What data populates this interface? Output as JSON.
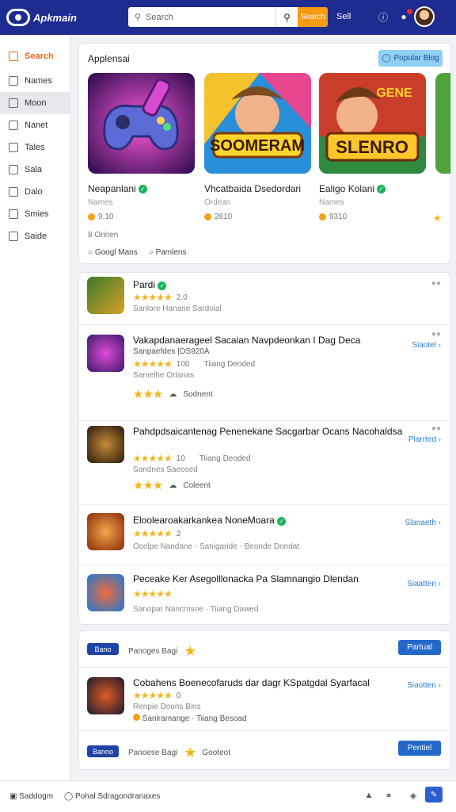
{
  "header": {
    "logo_text": "Apkmain",
    "search_placeholder": "Search",
    "search_go": "Search",
    "link": "Sell"
  },
  "sidebar": {
    "items": [
      {
        "label": "Search"
      },
      {
        "label": "Names"
      },
      {
        "label": "Moon"
      },
      {
        "label": "Nanet"
      },
      {
        "label": "Tales"
      },
      {
        "label": "Sala"
      },
      {
        "label": "Dalo"
      },
      {
        "label": "Smies"
      },
      {
        "label": "Saide"
      }
    ]
  },
  "featured": {
    "title": "Applensai",
    "button": "Popular Blog",
    "tiles": [
      {
        "name": "Neapanlani",
        "sub": "Names",
        "rating": "9.10"
      },
      {
        "name": "Vhcatbaida Dsedordari",
        "sub": "Ordean",
        "rating": "2810"
      },
      {
        "name": "Ealigo Kolani",
        "sub": "Names",
        "rating": "9310"
      }
    ],
    "foot1": "8 Orinen",
    "foot2a": "Googl Mans",
    "foot2b": "Pamlens"
  },
  "list": [
    {
      "title": "Pardi",
      "rating": "2.0",
      "meta": "Sanlore Hanane Sardolal"
    },
    {
      "title": "Vakapdanaerageel Sacaian Navpdeonkan I Dag Deca",
      "sub": "Sanpaefdes |OS920A",
      "rating": "100",
      "meta": "Samelhe Orlanas",
      "extra": "Tiiang Deoded",
      "mini": "Sodnent",
      "link": "Siaotel"
    },
    {
      "title": "Pahdpdsaicantenag Penenekane Sacgarbar Ocans Nacohaldsa",
      "rating": "10",
      "meta": "Sandnes Saeosed",
      "extra": "Tiiang Deoded",
      "mini": "Coleent",
      "link": "Plarrted"
    },
    {
      "title": "Eloolearoakarkankea NoneMoara",
      "rating": "2",
      "meta": "Ocelpe Nandane · Sanigaride · Beonde Dondat",
      "link": "Slanaeth"
    },
    {
      "title": "Peceake Ker Asegolllonacka Pa Slamnangio Dlendan",
      "meta": "Sanopar Nancrnsoe · Tiiang Dawed",
      "link": "Siaatten"
    }
  ],
  "bottom": {
    "row1": {
      "pill": "Bano",
      "label": "Panoges Bagi",
      "button": "Partual"
    },
    "row2": {
      "title": "Cobahens Boenecofaruds dar dagr KSpatgdal Syarfacal",
      "rating": "0",
      "meta": "Renpie Doons Bins",
      "extra": "Sanlramange · Tiiang Besoad",
      "link": "Siaotten"
    },
    "row3": {
      "pill": "Banno",
      "label": "Panoese Bagi",
      "mini": "Gooteot",
      "button": "Pentiel"
    }
  },
  "footer": {
    "text1": "Saddogm",
    "text2": "Pohal Sdragondranaxes"
  }
}
